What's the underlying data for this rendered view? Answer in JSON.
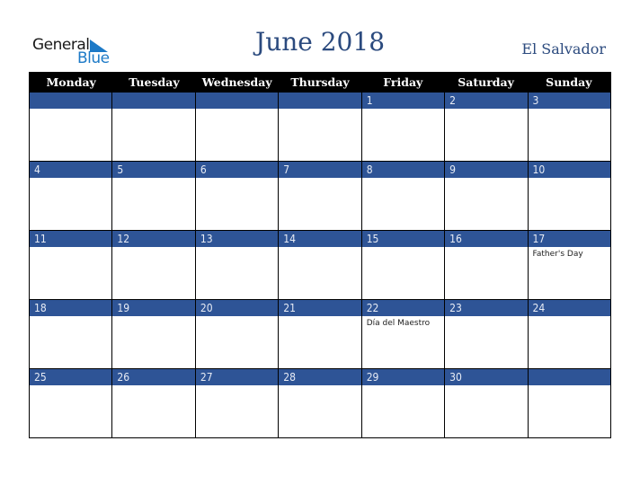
{
  "logo": {
    "word1": "General",
    "word2": "Blue"
  },
  "title": "June 2018",
  "country": "El Salvador",
  "colors": {
    "header_bg": "#000000",
    "day_band": "#2e5496",
    "title": "#2b4a7e",
    "logo_blue": "#1d7ac7"
  },
  "days": [
    "Monday",
    "Tuesday",
    "Wednesday",
    "Thursday",
    "Friday",
    "Saturday",
    "Sunday"
  ],
  "weeks": [
    [
      {
        "d": ""
      },
      {
        "d": ""
      },
      {
        "d": ""
      },
      {
        "d": ""
      },
      {
        "d": "1"
      },
      {
        "d": "2"
      },
      {
        "d": "3"
      }
    ],
    [
      {
        "d": "4"
      },
      {
        "d": "5"
      },
      {
        "d": "6"
      },
      {
        "d": "7"
      },
      {
        "d": "8"
      },
      {
        "d": "9"
      },
      {
        "d": "10"
      }
    ],
    [
      {
        "d": "11"
      },
      {
        "d": "12"
      },
      {
        "d": "13"
      },
      {
        "d": "14"
      },
      {
        "d": "15"
      },
      {
        "d": "16"
      },
      {
        "d": "17",
        "e": "Father's Day"
      }
    ],
    [
      {
        "d": "18"
      },
      {
        "d": "19"
      },
      {
        "d": "20"
      },
      {
        "d": "21"
      },
      {
        "d": "22",
        "e": "Día del Maestro"
      },
      {
        "d": "23"
      },
      {
        "d": "24"
      }
    ],
    [
      {
        "d": "25"
      },
      {
        "d": "26"
      },
      {
        "d": "27"
      },
      {
        "d": "28"
      },
      {
        "d": "29"
      },
      {
        "d": "30"
      },
      {
        "d": ""
      }
    ]
  ]
}
